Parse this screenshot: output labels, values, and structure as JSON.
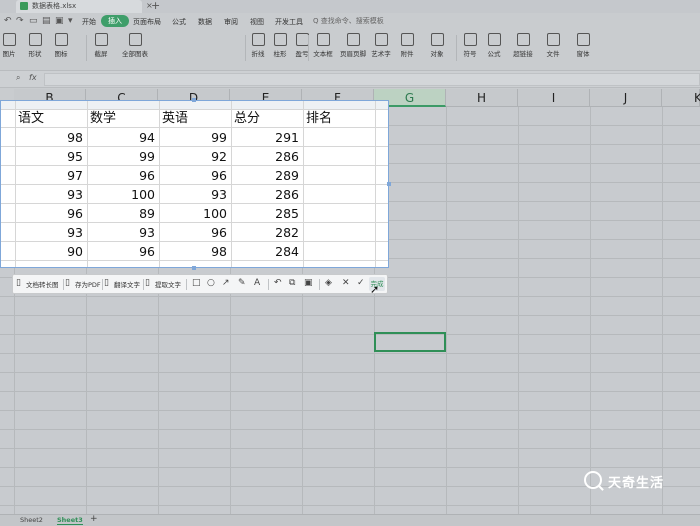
{
  "window": {
    "doc_tab": "数据表格.xlsx",
    "close_glyph": "×",
    "new_tab_glyph": "+"
  },
  "menu": {
    "items": [
      "开始",
      "插入",
      "页面布局",
      "公式",
      "数据",
      "审阅",
      "视图",
      "开发工具"
    ],
    "active": "插入",
    "search_text": "Q 查找命令、搜索模板"
  },
  "ribbon": {
    "buttons": [
      "图片",
      "形状",
      "图标",
      "截屏",
      "全部图表",
      "折线",
      "柱形",
      "盈亏",
      "文本框",
      "页眉页脚",
      "艺术字",
      "附件",
      "对象",
      "符号",
      "公式",
      "超链接",
      "文件",
      "窗体"
    ]
  },
  "formula_bar": {
    "icons": [
      "zoom-icon",
      "fx-icon"
    ],
    "fx_label": "fx"
  },
  "columns": [
    "B",
    "C",
    "D",
    "E",
    "F",
    "G",
    "H",
    "I",
    "J",
    "K"
  ],
  "selected_column": "G",
  "screenshot_region": {
    "headers": [
      "语文",
      "数学",
      "英语",
      "总分",
      "排名"
    ],
    "rows": [
      [
        "98",
        "94",
        "99",
        "291",
        ""
      ],
      [
        "95",
        "99",
        "92",
        "286",
        ""
      ],
      [
        "97",
        "96",
        "96",
        "289",
        ""
      ],
      [
        "93",
        "100",
        "93",
        "286",
        ""
      ],
      [
        "96",
        "89",
        "100",
        "285",
        ""
      ],
      [
        "93",
        "93",
        "96",
        "282",
        ""
      ],
      [
        "90",
        "96",
        "98",
        "284",
        ""
      ]
    ]
  },
  "capture_toolbar": {
    "text_buttons": [
      "文档转长图",
      "存为PDF",
      "翻译文字",
      "提取文字"
    ],
    "done_label": "完成"
  },
  "status": {
    "sheets": [
      "Sheet2",
      "Sheet3"
    ],
    "active_sheet": "Sheet3",
    "add_sheet": "+"
  },
  "watermark": {
    "text": "天奇生活"
  }
}
